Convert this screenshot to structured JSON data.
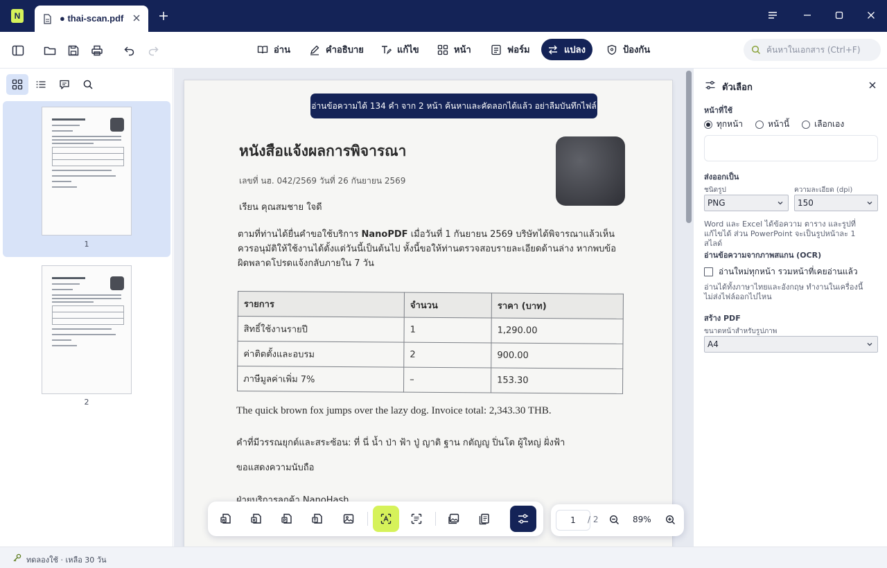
{
  "titlebar": {
    "tab_title": "● thai-scan.pdf"
  },
  "toolbar": {
    "modes": [
      {
        "label": "อ่าน",
        "icon": "book-icon"
      },
      {
        "label": "คำอธิบาย",
        "icon": "pen-icon"
      },
      {
        "label": "แก้ไข",
        "icon": "text-edit-icon"
      },
      {
        "label": "หน้า",
        "icon": "grid-icon"
      },
      {
        "label": "ฟอร์ม",
        "icon": "form-icon"
      },
      {
        "label": "แปลง",
        "icon": "convert-icon"
      },
      {
        "label": "ป้องกัน",
        "icon": "shield-icon"
      }
    ],
    "active_mode": "แปลง",
    "search_placeholder": "ค้นหาในเอกสาร (Ctrl+F)"
  },
  "sidebar": {
    "pages": [
      "1",
      "2"
    ],
    "selected_page": "1"
  },
  "document": {
    "banner": "อ่านข้อความได้ 134 คำ จาก 2 หน้า ค้นหาและคัดลอกได้แล้ว อย่าลืมบันทึกไฟล์",
    "title": "หนังสือแจ้งผลการพิจารณา",
    "ref": "เลขที่ นฮ. 042/2569   วันที่ 26 กันยายน 2569",
    "to": "เรียน คุณสมชาย ใจดี",
    "para_before": "ตามที่ท่านได้ยื่นคำขอใช้บริการ ",
    "para_brand": "NanoPDF",
    "para_after": " เมื่อวันที่ 1 กันยายน 2569 บริษัทได้พิจารณาแล้วเห็นควรอนุมัติให้ใช้งานได้ตั้งแต่วันนี้เป็นต้นไป หั้งนี้ขอให้ท่านตรวจสอบรายละเอียดด้านล่าง หากพบข้อผิดพลาดโปรดแจ้งกลับภายใน 7 วัน",
    "table": {
      "headers": [
        "รายการ",
        "จำนวน",
        "ราคา (บาท)"
      ],
      "rows": [
        [
          "สิทธิ์ใช้งานรายปี",
          "1",
          "1,290.00"
        ],
        [
          "ค่าติดตั้งและอบรม",
          "2",
          "900.00"
        ],
        [
          "ภาษีมูลค่าเพิ่ม 7%",
          "–",
          "153.30"
        ]
      ]
    },
    "english_line": "The quick brown fox jumps over the lazy dog. Invoice total: 2,343.30 THB.",
    "thai_test_line": "คำที่มีวรรณยุกต์และสระซ้อน: ที่ นี่ น้ำ ป่า ฟ้า ปู่ ญาติ ฐาน กตัญญู ปิ่นโต ผู้ใหญ่ ฝั่งฟ้า",
    "regards": "ขอแสดงความนับถือ",
    "signature": "ฝ่ายบริการลูกค้า NanoHash"
  },
  "page_nav": {
    "current": "1",
    "total": "/ 2",
    "zoom": "89%"
  },
  "panel": {
    "title": "ตัวเลือก",
    "pages_label": "หน้าที่ใช้",
    "radio_options": [
      "ทุกหน้า",
      "หน้านี้",
      "เลือกเอง"
    ],
    "radio_selected": "ทุกหน้า",
    "export_label": "ส่งออกเป็น",
    "format_label": "ชนิดรูป",
    "format_value": "PNG",
    "dpi_label": "ความละเอียด (dpi)",
    "dpi_value": "150",
    "export_note": "Word และ Excel ได้ข้อความ ตาราง และรูปที่แก้ไขได้ ส่วน PowerPoint จะเป็นรูปหน้าละ 1 สไลด์",
    "ocr_label": "อ่านข้อความจากภาพสแกน (OCR)",
    "ocr_checkbox": "อ่านใหม่ทุกหน้า รวมหน้าที่เคยอ่านแล้ว",
    "ocr_checked": false,
    "ocr_note": "อ่านได้ทั้งภาษาไทยและอังกฤษ ทำงานในเครื่องนี้ ไม่ส่งไฟล์ออกไปไหน",
    "create_label": "สร้าง PDF",
    "size_label": "ขนาดหน้าสำหรับรูปภาพ",
    "size_value": "A4"
  },
  "status": {
    "text": "ทดลองใช้ · เหลือ 30 วัน"
  },
  "colors": {
    "navy": "#142357",
    "lime": "#d6f25a",
    "selection": "#d8e3f8"
  }
}
